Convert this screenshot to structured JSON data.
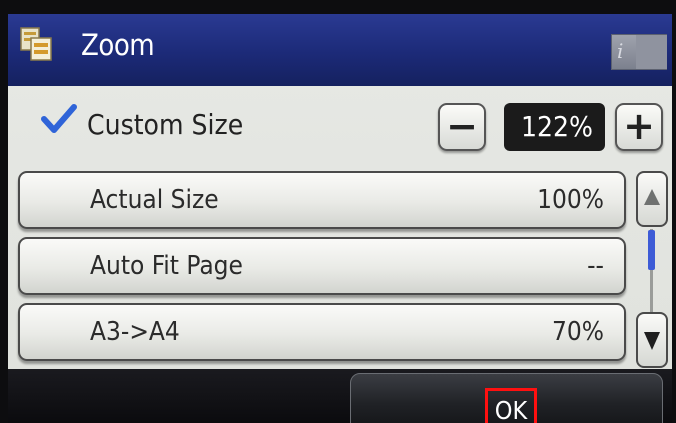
{
  "header": {
    "title": "Zoom",
    "icon": "zoom-copy-icon",
    "info_icon": "info-icon",
    "info_glyph": "i"
  },
  "custom_size": {
    "checked": true,
    "label": "Custom Size",
    "value": "122%",
    "decrement_glyph": "−",
    "increment_glyph": "+"
  },
  "zoom_options": [
    {
      "label": "Actual Size",
      "value": "100%"
    },
    {
      "label": "Auto Fit Page",
      "value": "--"
    },
    {
      "label": "A3->A4",
      "value": "70%"
    }
  ],
  "scrollbar": {
    "position_fraction": 0.0,
    "visible_fraction": 0.45
  },
  "footer": {
    "ok_label": "OK"
  },
  "colors": {
    "title_bar": "#1c2a78",
    "check": "#2f64d8",
    "scroll_thumb": "#3d5bd6",
    "highlight": "#ff1010"
  }
}
